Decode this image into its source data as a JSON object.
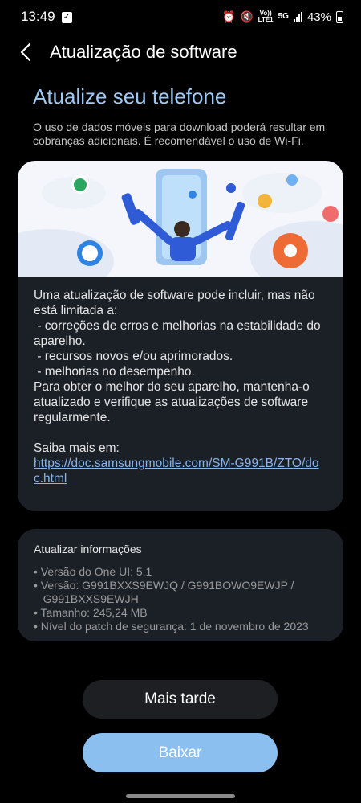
{
  "status_bar": {
    "time": "13:49",
    "network_top": "Vo))",
    "network_bottom": "LTE1",
    "network_gen": "5G",
    "battery": "43%"
  },
  "header": {
    "title": "Atualização de software"
  },
  "main": {
    "heading": "Atualize seu telefone",
    "subtext": "O uso de dados móveis para download poderá resultar em cobranças adicionais. É recomendável o uso de Wi-Fi."
  },
  "card": {
    "lines": [
      "Uma atualização de software pode incluir, mas não está limitada a:",
      " - correções de erros e melhorias na estabilidade do aparelho.",
      " - recursos novos e/ou aprimorados.",
      " - melhorias no desempenho.",
      "Para obter o melhor do seu aparelho, mantenha-o atualizado e verifique as atualizações de software regularmente."
    ],
    "learn_more": "Saiba mais em:",
    "link": "https://doc.samsungmobile.com/SM-G991B/ZTO/doc.html"
  },
  "info": {
    "title": "Atualizar informações",
    "lines": [
      "• Versão do One UI: 5.1",
      "• Versão: G991BXXS9EWJQ / G991BOWO9EWJP /",
      "   G991BXXS9EWJH",
      "• Tamanho: 245,24 MB",
      "• Nível do patch de segurança: 1 de novembro de 2023"
    ]
  },
  "buttons": {
    "later": "Mais tarde",
    "download": "Baixar"
  }
}
